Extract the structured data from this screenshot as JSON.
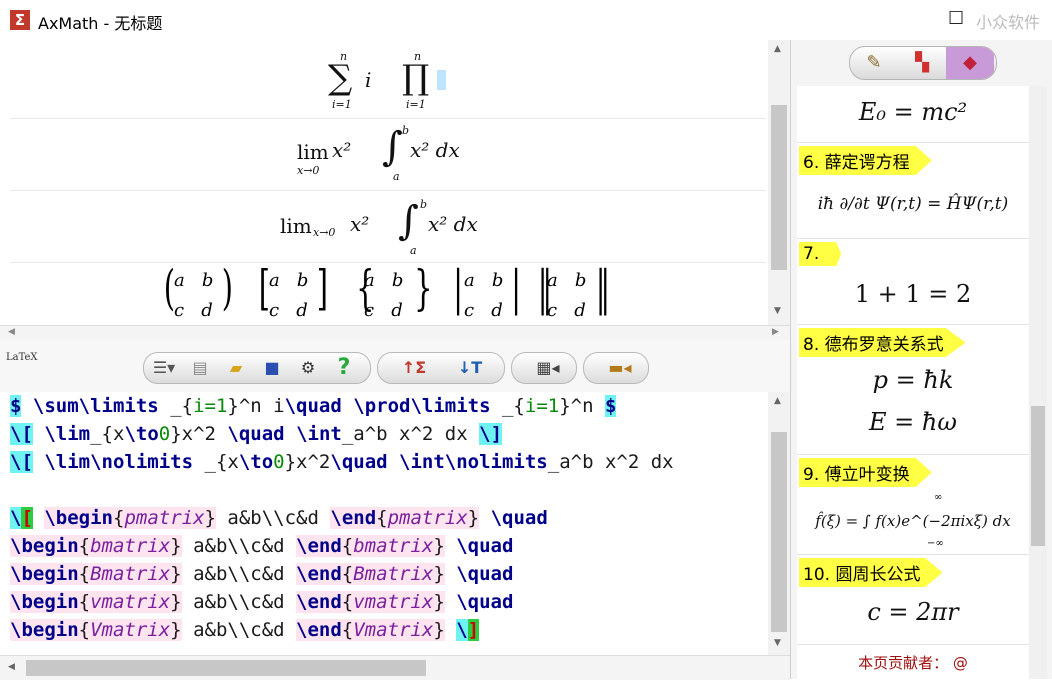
{
  "window": {
    "title": "AxMath - 无标题",
    "watermark": "小众软件",
    "app_icon": "sigma-icon"
  },
  "preview": {
    "row1": {
      "sum": "∑",
      "sum_top": "n",
      "sum_bottom": "i=1",
      "sum_body": "i",
      "prod": "∏",
      "prod_top": "n",
      "prod_bottom": "i=1"
    },
    "row2": {
      "lim": "lim",
      "lim_sub": "x→0",
      "lim_body": "x²",
      "int": "∫",
      "int_top": "b",
      "int_bottom": "a",
      "int_body": "x² dx"
    },
    "row3": {
      "lim": "lim",
      "lim_sub": "x→0",
      "lim_body": "x²",
      "int": "∫",
      "int_top": "b",
      "int_bottom": "a",
      "int_body": "x² dx"
    },
    "row4": [
      {
        "open": "(",
        "close": ")",
        "top": "a   b",
        "bottom": "c   d"
      },
      {
        "open": "[",
        "close": "]",
        "top": "a   b",
        "bottom": "c   d"
      },
      {
        "open": "{",
        "close": "}",
        "top": "a   b",
        "bottom": "c   d"
      },
      {
        "open": "|",
        "close": "|",
        "top": "a   b",
        "bottom": "c   d"
      },
      {
        "open": "‖",
        "close": "‖",
        "top": "a   b",
        "bottom": "c   d"
      }
    ]
  },
  "toolbar": {
    "latex_logo": "LaTeX",
    "buttons": [
      "list-dropdown-icon",
      "document-icon",
      "folder-open-icon",
      "save-icon",
      "settings-icon",
      "help-icon",
      "import-sigma-icon",
      "export-text-icon",
      "clipboard-icon",
      "briefcase-icon"
    ],
    "help_label": "?"
  },
  "editor": {
    "lines": [
      "$ \\sum\\limits _{i=1}^n i\\quad \\prod\\limits _{i=1}^n $",
      "\\[ \\lim_{x\\to0}x^2 \\quad \\int_a^b x^2 dx \\]",
      "\\[ \\lim\\nolimits _{x\\to0}x^2\\quad \\int\\nolimits_a^b x^2 dx",
      "",
      "\\[ \\begin{pmatrix} a&b\\\\c&d \\end{pmatrix} \\quad",
      "\\begin{bmatrix} a&b\\\\c&d \\end{bmatrix} \\quad",
      "\\begin{Bmatrix} a&b\\\\c&d \\end{Bmatrix} \\quad",
      "\\begin{vmatrix} a&b\\\\c&d \\end{vmatrix} \\quad",
      "\\begin{Vmatrix} a&b\\\\c&d \\end{Vmatrix} \\]"
    ]
  },
  "right_panel": {
    "tabs": [
      "brush-icon",
      "grid-icon",
      "bookmark-icon"
    ],
    "items": [
      {
        "title": "",
        "formula": "E₀ = mc²"
      },
      {
        "title": "6. 薛定谔方程",
        "formula": "iħ ∂/∂t Ψ(r,t) = ĤΨ(r,t)"
      },
      {
        "title": "7.",
        "formula": "1 + 1 = 2"
      },
      {
        "title": "8. 德布罗意关系式",
        "formula": "p = ħk",
        "formula2": "E = ħω"
      },
      {
        "title": "9. 傅立叶变换",
        "formula": "f̂(ξ) = ∫ f(x)e^(−2πixξ) dx",
        "int_top": "∞",
        "int_bottom": "−∞"
      },
      {
        "title": "10. 圆周长公式",
        "formula": "c = 2πr"
      }
    ],
    "footer": "本页贡献者： @"
  }
}
